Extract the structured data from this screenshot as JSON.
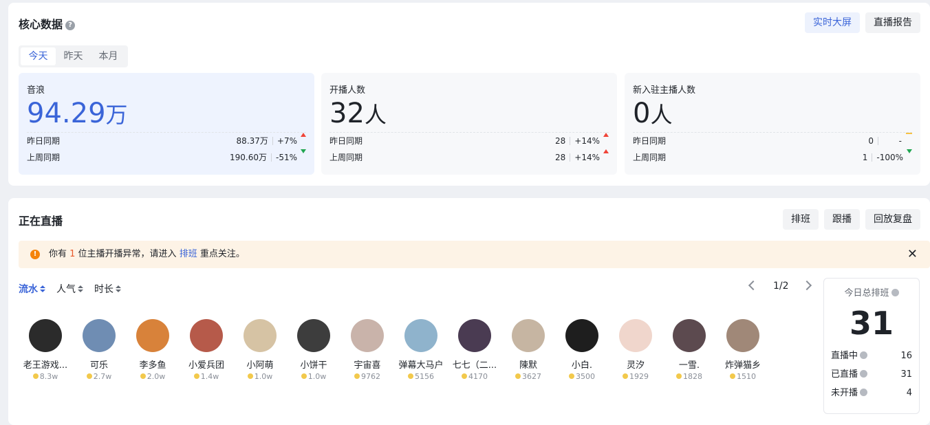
{
  "core": {
    "title": "核心数据",
    "btn_realtime": "实时大屏",
    "btn_report": "直播报告",
    "tabs": [
      "今天",
      "昨天",
      "本月"
    ],
    "active_tab": 0,
    "stats": [
      {
        "label": "音浪",
        "value": "94.29",
        "unit": "万",
        "rows": [
          {
            "label": "昨日同期",
            "value": "88.37万",
            "pct": "+7%",
            "trend": "up"
          },
          {
            "label": "上周同期",
            "value": "190.60万",
            "pct": "-51%",
            "trend": "down"
          }
        ]
      },
      {
        "label": "开播人数",
        "value": "32",
        "unit": "人",
        "rows": [
          {
            "label": "昨日同期",
            "value": "28",
            "pct": "+14%",
            "trend": "up"
          },
          {
            "label": "上周同期",
            "value": "28",
            "pct": "+14%",
            "trend": "up"
          }
        ]
      },
      {
        "label": "新入驻主播人数",
        "value": "0",
        "unit": "人",
        "rows": [
          {
            "label": "昨日同期",
            "value": "0",
            "pct": "-",
            "trend": "flat"
          },
          {
            "label": "上周同期",
            "value": "1",
            "pct": "-100%",
            "trend": "down"
          }
        ]
      }
    ]
  },
  "live": {
    "title": "正在直播",
    "btn_schedule": "排班",
    "btn_follow": "跟播",
    "btn_replay": "回放复盘",
    "alert": {
      "prefix": "你有 ",
      "count": "1",
      "middle": " 位主播开播异常，请进入 ",
      "link": "排班",
      "suffix": " 重点关注。"
    },
    "sorts": [
      "流水",
      "人气",
      "时长"
    ],
    "page": "1/2",
    "anchors": [
      {
        "name": "老王游戏...",
        "score": "8.3w",
        "color": "#2b2b2b"
      },
      {
        "name": "可乐",
        "score": "2.7w",
        "color": "#6f8db3"
      },
      {
        "name": "李多鱼",
        "score": "2.0w",
        "color": "#d8823a"
      },
      {
        "name": "小爱兵团",
        "score": "1.4w",
        "color": "#b65a4a"
      },
      {
        "name": "小阿萌",
        "score": "1.0w",
        "color": "#d6c3a4"
      },
      {
        "name": "小饼干",
        "score": "1.0w",
        "color": "#3d3d3d"
      },
      {
        "name": "宇宙喜",
        "score": "9762",
        "color": "#c9b3aa"
      },
      {
        "name": "弹幕大马户",
        "score": "5156",
        "color": "#8fb3cc"
      },
      {
        "name": "七七（二...",
        "score": "4170",
        "color": "#4a3b52"
      },
      {
        "name": "陳默",
        "score": "3627",
        "color": "#c6b5a2"
      },
      {
        "name": "小白.",
        "score": "3500",
        "color": "#1e1e1e"
      },
      {
        "name": "灵汐",
        "score": "1929",
        "color": "#f0d6cc"
      },
      {
        "name": "一雪.",
        "score": "1828",
        "color": "#5c4a4f"
      },
      {
        "name": "炸弹猫乡",
        "score": "1510",
        "color": "#a08878"
      }
    ],
    "schedule": {
      "title": "今日总排班",
      "total": "31",
      "rows": [
        {
          "label": "直播中",
          "value": "16"
        },
        {
          "label": "已直播",
          "value": "31"
        },
        {
          "label": "未开播",
          "value": "4"
        }
      ]
    }
  }
}
